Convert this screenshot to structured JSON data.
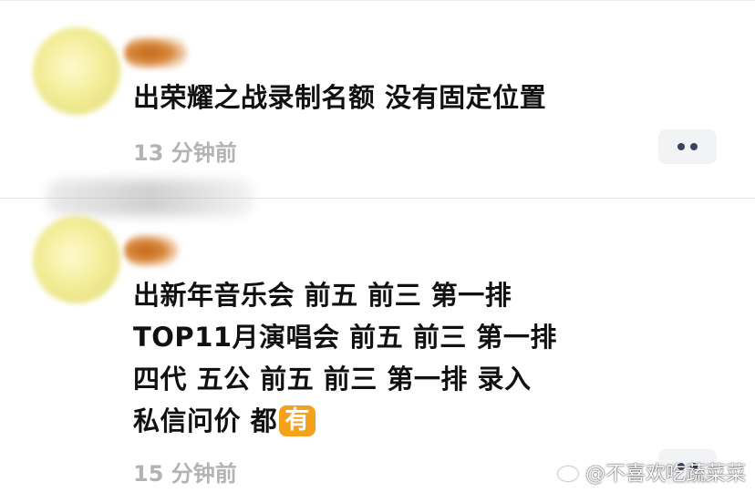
{
  "comments": [
    {
      "lines": [
        "出荣耀之战录制名额 没有固定位置"
      ],
      "time": "13 分钟前"
    },
    {
      "lines": [
        "出新年音乐会 前五 前三 第一排",
        "TOP11月演唱会 前五 前三 第一排",
        "四代 五公 前五 前三 第一排 录入",
        "私信问价 都"
      ],
      "emoji_badge": "有",
      "time": "15 分钟前"
    }
  ],
  "watermark": {
    "icon": "weibo-icon",
    "text": "@不喜欢吃蔬菜菜"
  },
  "colors": {
    "text": "#111111",
    "timestamp": "#b3b3b3",
    "more_button_bg": "#f2f3f5",
    "emoji_badge_bg": "#f4a21c"
  }
}
